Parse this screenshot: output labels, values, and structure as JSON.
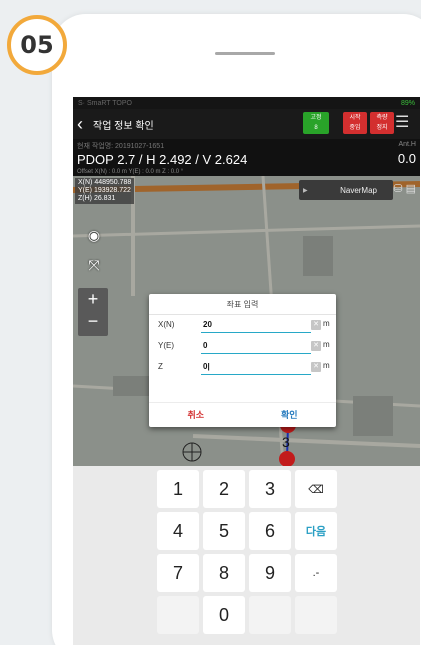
{
  "step": {
    "label": "05"
  },
  "statusbar": {
    "left": "S· SmaRT TOPO",
    "right": "89%"
  },
  "appbar": {
    "title": "작업 정보 확인",
    "fix": {
      "line1": "고정",
      "line2": "8"
    },
    "box2": {
      "line1": "시작",
      "line2": "중임"
    },
    "box3": {
      "line1": "측량",
      "line2": "정지"
    }
  },
  "info": {
    "sub": "현재 작업명: 20191027-1651",
    "pdop": "PDOP 2.7 / H 2.492 / V 2.624",
    "anth_label": "Ant.H",
    "anth_value": "0.0",
    "offset": "Offset   X(N) : 0.0 m    Y(E) : 0.0 m    Z : 0.0 °"
  },
  "map": {
    "coords": [
      "X(N) 448950.788",
      "Y(E) 193928.722",
      "Z(H) 26.831"
    ],
    "navermap": "NaverMap",
    "point_labels": [
      "4",
      "0",
      "1",
      "2",
      "3"
    ]
  },
  "dialog": {
    "title": "좌표 입력",
    "rows": [
      {
        "label": "X(N)",
        "value": "20",
        "unit": "m"
      },
      {
        "label": "Y(E)",
        "value": "0",
        "unit": "m"
      },
      {
        "label": "Z",
        "value": "0|",
        "unit": "m"
      }
    ],
    "cancel": "취소",
    "ok": "확인"
  },
  "keyboard": {
    "keys": [
      "1",
      "2",
      "3",
      "4",
      "5",
      "6",
      "7",
      "8",
      "9",
      "0"
    ],
    "next": "다음",
    "symbols": ".-"
  }
}
